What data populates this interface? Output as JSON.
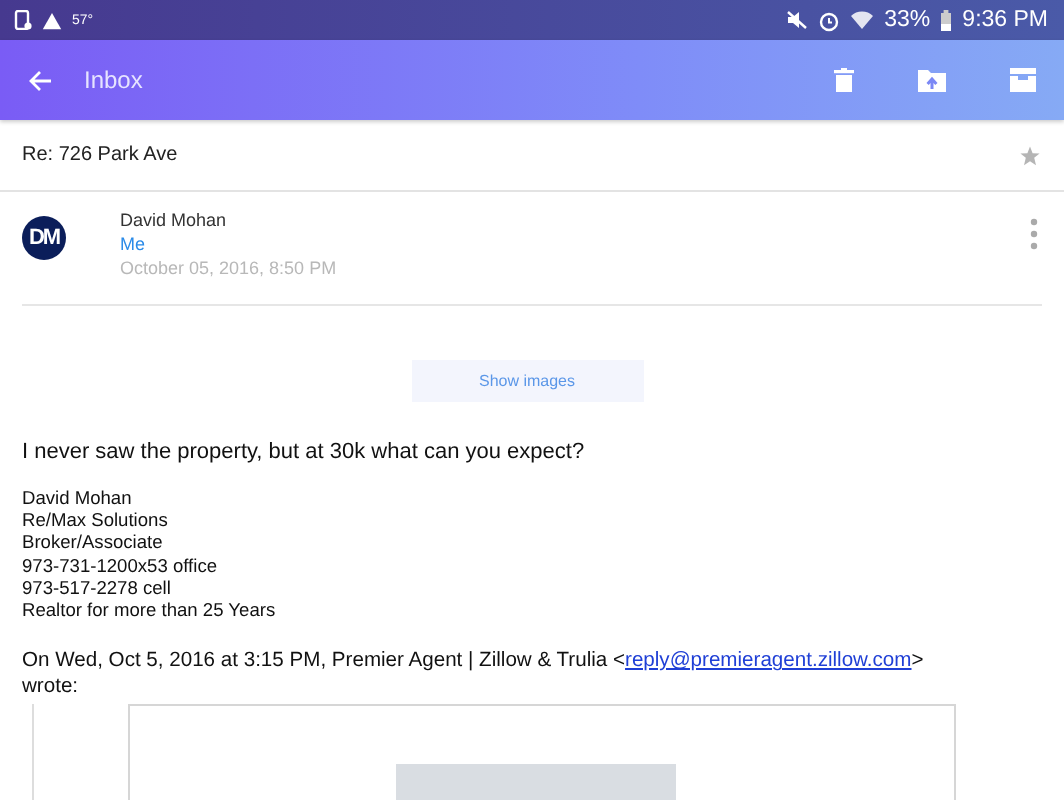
{
  "status_bar": {
    "temperature": "57°",
    "battery": "33%",
    "time": "9:36 PM"
  },
  "app_bar": {
    "title": "Inbox"
  },
  "message": {
    "subject": "Re: 726 Park Ave",
    "starred": false,
    "avatar": "DM",
    "sender": "David Mohan",
    "recipient": "Me",
    "date": "October 05, 2016, 8:50 PM",
    "show_images": "Show images",
    "body": "I never saw the property, but at 30k what can you expect?",
    "signature": [
      "David Mohan",
      "Re/Max Solutions",
      "Broker/Associate",
      "973-731-1200x53 office",
      "973-517-2278 cell",
      "Realtor for more than 25 Years"
    ],
    "quote_intro": "On Wed, Oct 5, 2016 at 3:15 PM, Premier Agent | Zillow & Trulia <",
    "quote_link": "reply@premieragent.zillow.com",
    "quote_close": ">",
    "quote_wrote": "wrote:"
  }
}
